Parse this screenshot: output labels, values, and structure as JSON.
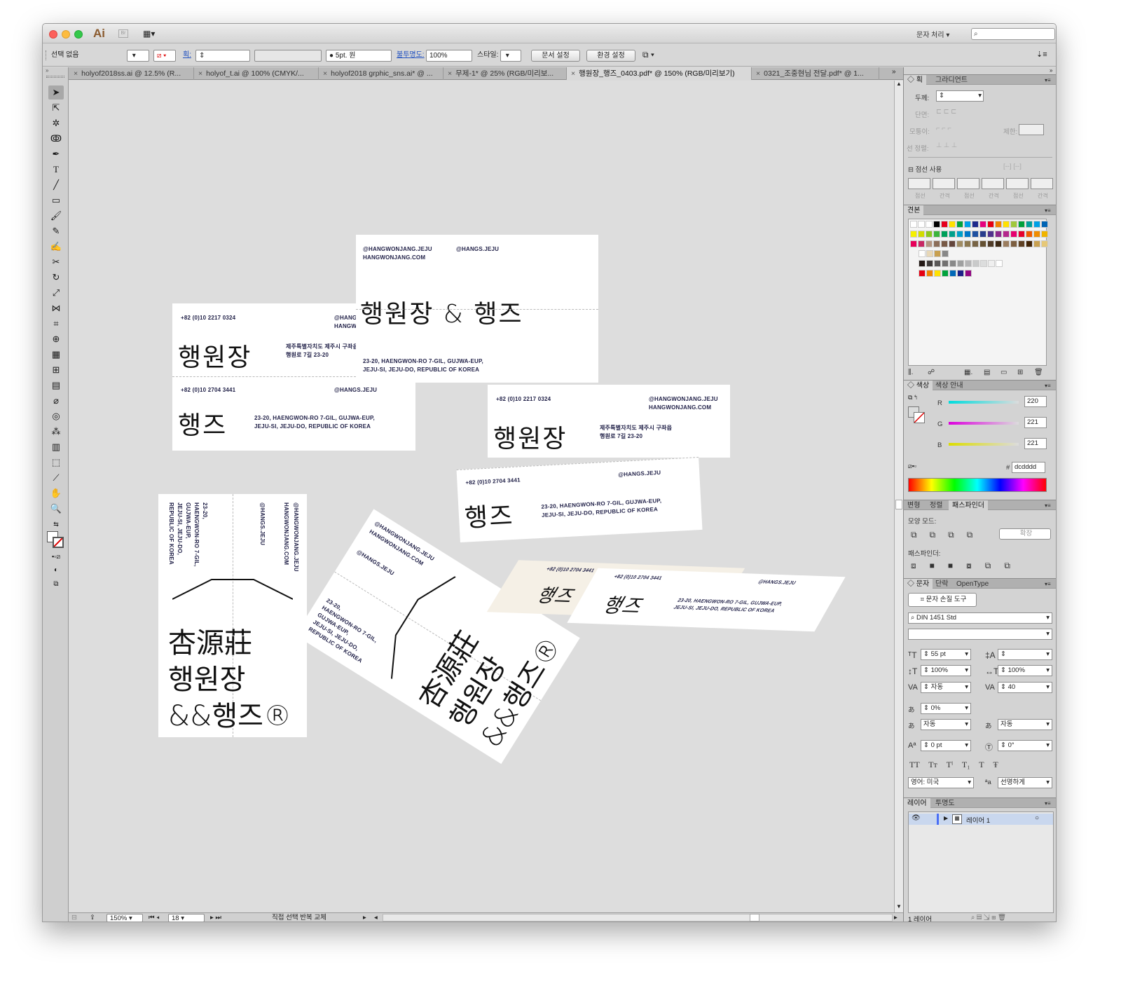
{
  "app": {
    "logo": "Ai",
    "bridge": "Br",
    "arrange_icon": "▦▾",
    "workspace": "문자 처리"
  },
  "control": {
    "selection": "선택 없음",
    "stroke_label": "획:",
    "brush": "5pt. 원",
    "opacity_label": "불투명도:",
    "opacity": "100%",
    "style_label": "스타일:",
    "doc_setup": "문서 설정",
    "prefs": "환경 설정"
  },
  "tabs": [
    "holyof2018ss.ai @ 12.5% (R...",
    "holyof_t.ai @ 100% (CMYK/...",
    "holyof2018 grphic_sns.ai* @ ...",
    "무제-1* @ 25% (RGB/미리보...",
    "행원장_행즈_0403.pdf* @ 150% (RGB/미리보기)",
    "0321_조중현님 전달.pdf* @ 1..."
  ],
  "status": {
    "zoom": "150%",
    "page": "18",
    "tool": "직접 선택 반복 교체"
  },
  "cards": {
    "insta_main": "@HANGWONJANG.JEJU",
    "site": "HANGWONJANG.COM",
    "insta_hangs": "@HANGS.JEJU",
    "phone1": "+82 (0)10 2217 0324",
    "phone2": "+82 (0)10 2704 3441",
    "addr_kr1": "제주특별자치도 제주시 구좌읍",
    "addr_kr2": "행원로 7길 23-20",
    "addr_en1": "23-20, HAENGWON-RO 7-GIL, GUJWA-EUP,",
    "addr_en2": "JEJU-SI, JEJU-DO, REPUBLIC OF KOREA",
    "v1": "23-20,",
    "v2": "HAENGWON-RO 7-GIL,",
    "v3": "GUJWA-EUP,",
    "v4": "JEJU-SI, JEJU-DO,",
    "v5": "REPUBLIC OF KOREA",
    "logo_hwj": "행원장",
    "logo_full": "행원장 & 행즈",
    "logo_hangs": "행즈",
    "hanja": "杏源莊",
    "amp": "&&행즈®",
    "logo_hangs_full": "행원장 & 행즈"
  },
  "panels": {
    "stroke_tab": "획",
    "gradient_tab": "그라디언트",
    "weight": "두께:",
    "cap": "단면:",
    "corner": "모퉁이:",
    "limit": "제한:",
    "align": "선 정렬:",
    "dashed": "점선 사용",
    "dash_labels": [
      "점선",
      "간격",
      "점선",
      "간격",
      "점선",
      "간격"
    ],
    "swatches_tab": "견본",
    "color_tab": "색상",
    "color_guide_tab": "색상 안내",
    "r": "220",
    "g": "221",
    "b": "221",
    "r_label": "R",
    "g_label": "G",
    "b_label": "B",
    "hex": "dcdddd",
    "transform_tab": "변형",
    "align_tab": "정렬",
    "pathfinder_tab": "패스파인더",
    "shape_modes": "모양 모드:",
    "expand": "확장",
    "pathfinders": "패스파인더:",
    "char_tab": "문자",
    "para_tab": "단락",
    "opentype_tab": "OpenType",
    "touch_type": "문자 손질 도구",
    "font": "DIN 1451 Std",
    "size": "55 pt",
    "scale_v": "100%",
    "scale_h": "100%",
    "kerning": "자동",
    "tracking": "40",
    "tsume": "0%",
    "aki_l": "자동",
    "aki_r": "자동",
    "baseline": "0 pt",
    "rotate": "0°",
    "language": "영어: 미국",
    "aa": "선명하게",
    "layers_tab": "레이어",
    "transparency_tab": "투명도",
    "layer_name": "레이어 1",
    "layer_count": "1 레이어"
  },
  "colors": {
    "accent": "#c9d7ee",
    "canvas": "#dddddd"
  }
}
